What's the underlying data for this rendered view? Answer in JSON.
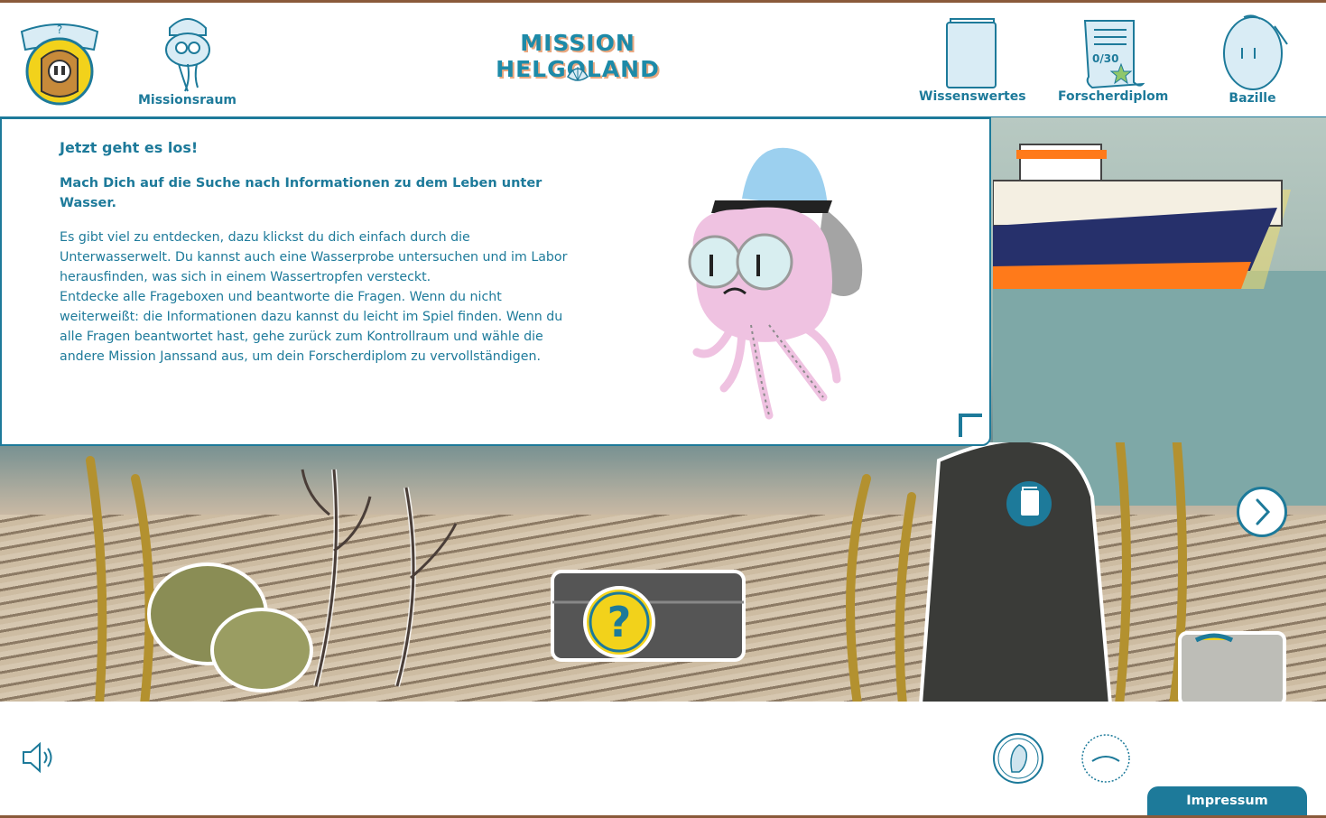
{
  "header": {
    "title": "MISSION HELGOLAND",
    "nav": {
      "missionsraum": "Missionsraum",
      "wissenswertes": "Wissenswertes",
      "forscherdiplom": "Forscherdiplom",
      "bazille": "Bazille"
    },
    "diploma_progress_label": "0/30"
  },
  "dialog": {
    "heading": "Jetzt geht es los!",
    "subheading": "Mach Dich auf die Suche nach Informationen zu dem Leben unter Wasser.",
    "body": "Es gibt viel zu entdecken, dazu klickst du dich einfach durch die Unterwasserwelt. Du kannst auch eine Wasserprobe untersuchen und im Labor herausfinden, was sich in einem Wassertropfen versteckt.\nEntdecke alle Frageboxen und beantworte die Fragen. Wenn du nicht weiterweißt: die Informationen dazu kannst du leicht im Spiel finden. Wenn du alle Fragen beantwortet hast, gehe zurück zum Kontrollraum und wähle die andere Mission Janssand aus, um dein Forscherdiplom zu vervollständigen."
  },
  "scene": {
    "question_box_symbol": "?"
  },
  "footer": {
    "impressum": "Impressum"
  },
  "colors": {
    "primary": "#1d7a9a",
    "title_shadow": "#e9a77f",
    "frame": "#8a5a3a",
    "yellow": "#f2d21b"
  }
}
